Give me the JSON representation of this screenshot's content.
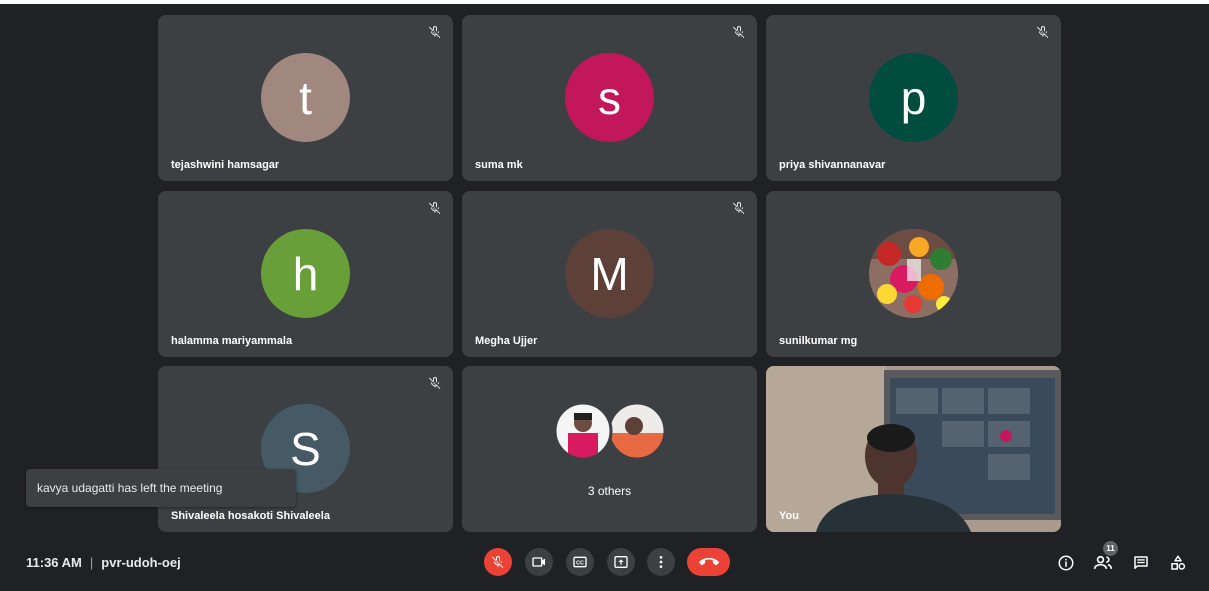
{
  "participants": [
    {
      "initial": "t",
      "name": "tejashwini hamsagar",
      "color": "#a1887f"
    },
    {
      "initial": "s",
      "name": "suma mk",
      "color": "#c2185b"
    },
    {
      "initial": "p",
      "name": "priya shivannanavar",
      "color": "#004d40"
    },
    {
      "initial": "h",
      "name": "halamma mariyammala",
      "color": "#689f38"
    },
    {
      "initial": "M",
      "name": "Megha Ujjer",
      "color": "#5d4037"
    },
    {
      "initial": "",
      "name": "sunilkumar mg",
      "color": "#8d6e63"
    },
    {
      "initial": "S",
      "name": "Shivaleela hosakoti Shivaleela",
      "color": "#455a64"
    }
  ],
  "others": {
    "label": "3 others"
  },
  "self": {
    "name": "You"
  },
  "toast": {
    "text": "kavya udagatti has left the meeting"
  },
  "bottom": {
    "time": "11:36 AM",
    "separator": "|",
    "meeting_code": "pvr-udoh-oej"
  },
  "people_count": "11",
  "icons": {
    "mute": "mic-off-icon",
    "camera": "videocam-icon",
    "captions": "closed-caption-icon",
    "present": "present-screen-icon",
    "more": "more-vert-icon",
    "end": "call-end-icon",
    "info": "info-icon",
    "people": "people-icon",
    "chat": "chat-icon",
    "activities": "activities-icon"
  },
  "colors": {
    "background": "#202124",
    "tile": "#3c4043",
    "danger": "#ea4335"
  }
}
